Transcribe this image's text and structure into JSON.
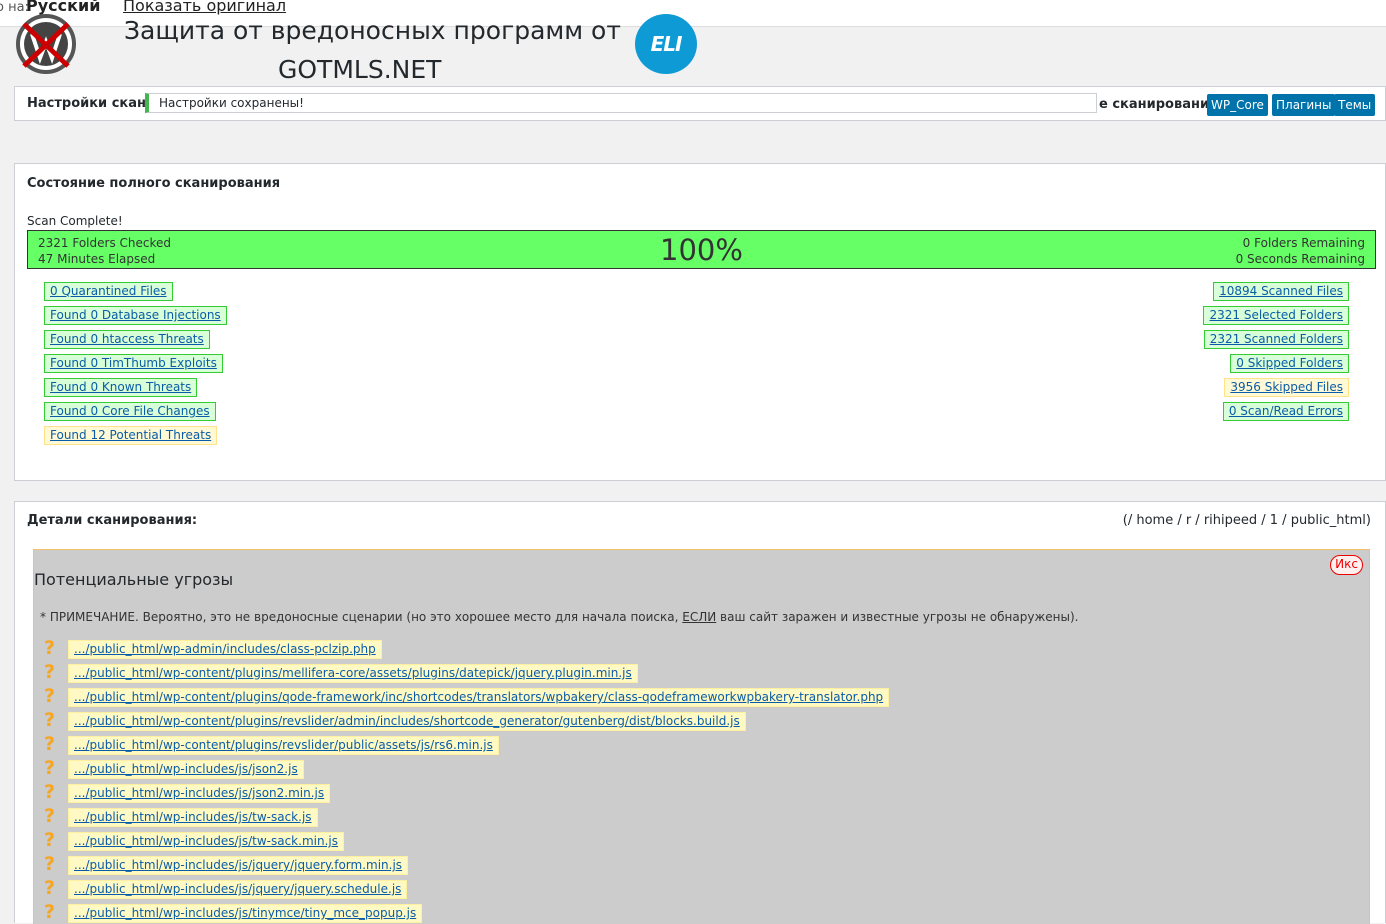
{
  "translate_bar": {
    "prefix": "о на:",
    "language": "Русский",
    "show_original": "Показать оригинал"
  },
  "header": {
    "title_line1": "Защита от вредоносных программ от",
    "title_line2": "GOTMLS.NET",
    "partner_logo_text": "ELI"
  },
  "settings": {
    "label": "Настройки сканир",
    "saved_notice": "Настройки сохранены!",
    "quick_scan_label": "е сканирование:",
    "buttons": [
      "WP_Core",
      "Плагины",
      "Темы"
    ]
  },
  "status": {
    "title": "Состояние полного сканирования",
    "scan_complete": "Scan Complete!",
    "folders_checked": "2321 Folders Checked",
    "minutes_elapsed": "47 Minutes Elapsed",
    "percent": "100%",
    "folders_remaining": "0 Folders Remaining",
    "seconds_remaining": "0 Seconds Remaining",
    "progress_fraction": 1.0,
    "left_stats": [
      {
        "label": "0 Quarantined Files",
        "status": "ok"
      },
      {
        "label": "Found 0 Database Injections",
        "status": "ok"
      },
      {
        "label": "Found 0 htaccess Threats",
        "status": "ok"
      },
      {
        "label": "Found 0 TimThumb Exploits",
        "status": "ok"
      },
      {
        "label": "Found 0 Known Threats",
        "status": "ok"
      },
      {
        "label": "Found 0 Core File Changes",
        "status": "ok"
      },
      {
        "label": "Found 12 Potential Threats",
        "status": "warn"
      }
    ],
    "right_stats": [
      {
        "label": "10894 Scanned Files",
        "status": "ok"
      },
      {
        "label": "2321 Selected Folders",
        "status": "ok"
      },
      {
        "label": "2321 Scanned Folders",
        "status": "ok"
      },
      {
        "label": "0 Skipped Folders",
        "status": "ok"
      },
      {
        "label": "3956 Skipped Files",
        "status": "warn"
      },
      {
        "label": "0 Scan/Read Errors",
        "status": "ok"
      }
    ]
  },
  "details": {
    "title": "Детали сканирования:",
    "path": "(/ home / r / rihipeed / 1 / public_html)",
    "potential": {
      "title": "Потенциальные угрозы",
      "close_label": "Икс",
      "note_before": "* ПРИМЕЧАНИЕ. Вероятно, это не вредоносные сценарии (но это хорошее место для начала поиска, ",
      "note_emph": "ЕСЛИ",
      "note_after": " ваш сайт заражен и известные угрозы не обнаружены).",
      "icon": "question-mark-icon",
      "files": [
        ".../public_html/wp-admin/includes/class-pclzip.php",
        ".../public_html/wp-content/plugins/mellifera-core/assets/plugins/datepick/jquery.plugin.min.js",
        ".../public_html/wp-content/plugins/qode-framework/inc/shortcodes/translators/wpbakery/class-qodeframeworkwpbakery-translator.php",
        ".../public_html/wp-content/plugins/revslider/admin/includes/shortcode_generator/gutenberg/dist/blocks.build.js",
        ".../public_html/wp-content/plugins/revslider/public/assets/js/rs6.min.js",
        ".../public_html/wp-includes/js/json2.js",
        ".../public_html/wp-includes/js/json2.min.js",
        ".../public_html/wp-includes/js/tw-sack.js",
        ".../public_html/wp-includes/js/tw-sack.min.js",
        ".../public_html/wp-includes/js/jquery/jquery.form.min.js",
        ".../public_html/wp-includes/js/jquery/jquery.schedule.js",
        ".../public_html/wp-includes/js/tinymce/tiny_mce_popup.js"
      ]
    }
  },
  "colors": {
    "progress_fill": "#66ff66",
    "ok_border": "#33cc33",
    "warn_border": "#ffe28a",
    "button_blue": "#0073aa",
    "notice_green": "#46b450",
    "threat_bg": "#cccccc"
  }
}
